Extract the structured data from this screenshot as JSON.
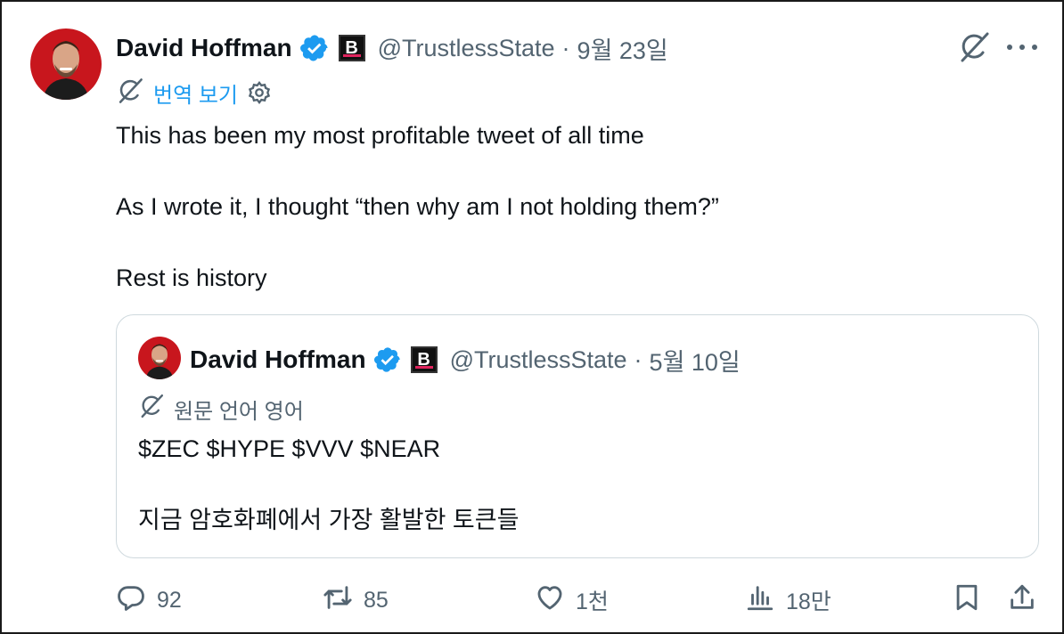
{
  "tweet": {
    "author_name": "David Hoffman",
    "handle": "@TrustlessState",
    "separator": "·",
    "date": "9월 23일",
    "translate_label": "번역 보기",
    "paragraphs": [
      "This has been my most profitable tweet of all time",
      "As I wrote it, I thought “then why am I not holding them?”",
      "Rest is history"
    ]
  },
  "quote": {
    "author_name": "David Hoffman",
    "handle": "@TrustlessState",
    "separator": "·",
    "date": "5월 10일",
    "language_label": "원문 언어 영어",
    "paragraphs": [
      "$ZEC $HYPE $VVV $NEAR",
      "지금 암호화폐에서 가장 활발한 토큰들"
    ]
  },
  "badge_letter": "B",
  "actions": {
    "reply_count": "92",
    "retweet_count": "85",
    "like_count": "1천",
    "views_count": "18만"
  },
  "icons": {
    "verified": "verified-badge-icon",
    "grok": "grok-icon",
    "more": "more-icon",
    "translate": "translate-icon",
    "settings": "gear-icon",
    "reply": "reply-icon",
    "retweet": "retweet-icon",
    "like": "heart-icon",
    "views": "views-icon",
    "bookmark": "bookmark-icon",
    "share": "share-icon"
  },
  "colors": {
    "link": "#1d9bf0",
    "muted": "#536471",
    "text": "#0f1419",
    "verified": "#1d9bf0",
    "avatar_bg": "#c8161d"
  }
}
